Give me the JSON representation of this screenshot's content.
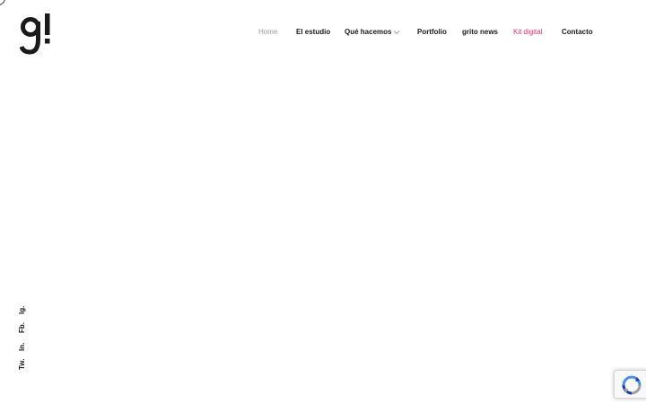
{
  "brand": {
    "logo_text": "g!"
  },
  "nav": {
    "items": [
      {
        "label": "Home"
      },
      {
        "label": "El estudio"
      },
      {
        "label": "Qué hacemos"
      },
      {
        "label": "Portfolio"
      },
      {
        "label": "grito news"
      },
      {
        "label": "Kit digital"
      },
      {
        "label": "Contacto"
      }
    ]
  },
  "social": {
    "items": [
      {
        "label": "Ig."
      },
      {
        "label": "Fb."
      },
      {
        "label": "In."
      },
      {
        "label": "Tw."
      }
    ]
  },
  "colors": {
    "background": "#ffffff",
    "text": "#1a1a1a",
    "muted": "#9a9a9a",
    "accent": "#d6336c"
  },
  "icons": {
    "dropdown": "chevron-down-icon",
    "recaptcha": "recaptcha-icon"
  }
}
